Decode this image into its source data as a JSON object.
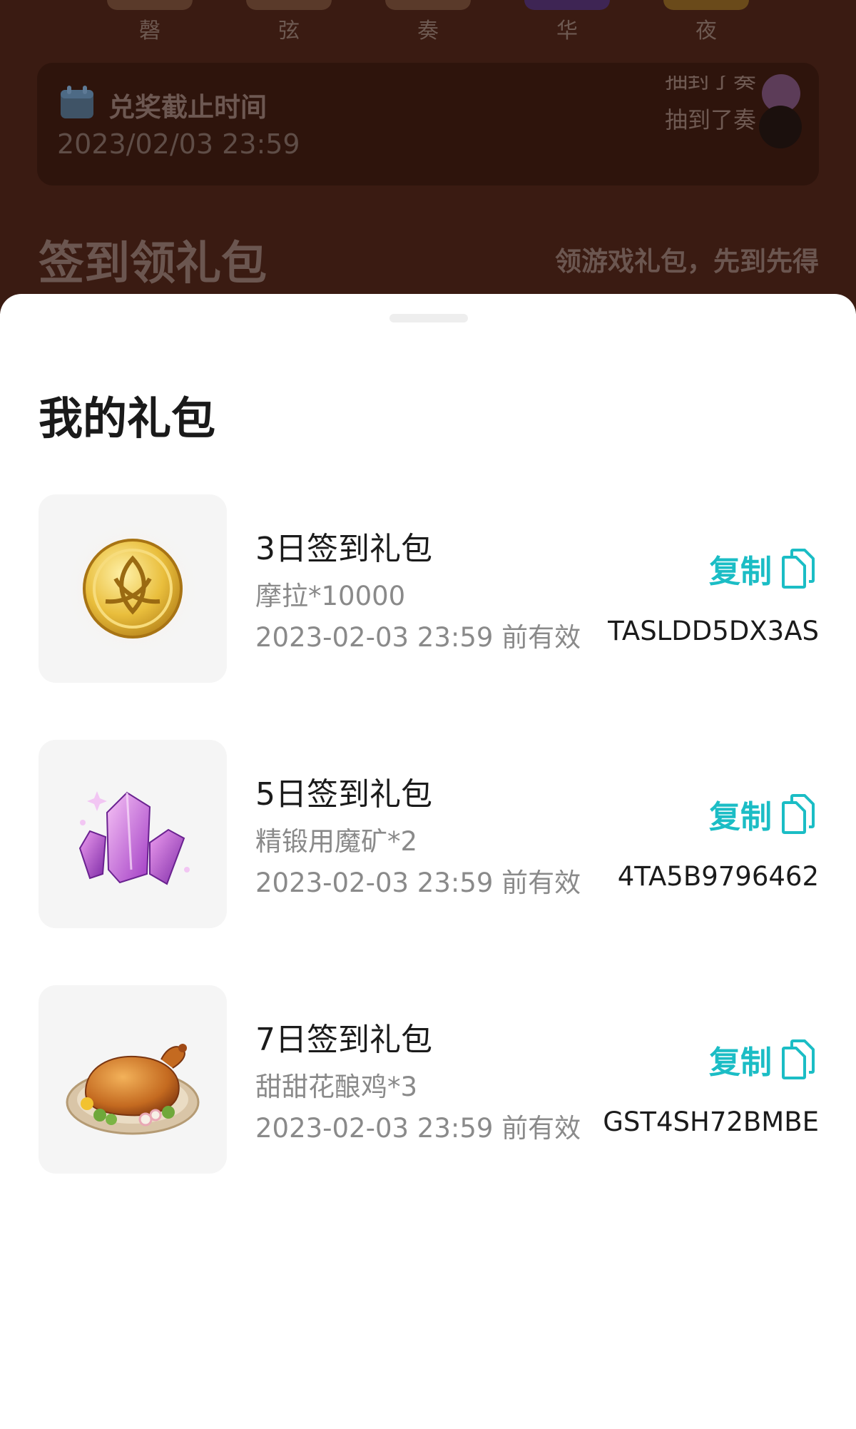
{
  "background": {
    "tabs": [
      {
        "label": "磬"
      },
      {
        "label": "弦"
      },
      {
        "label": "奏"
      },
      {
        "label": "华"
      },
      {
        "label": "夜"
      }
    ],
    "deadline": {
      "label": "兑奖截止时间",
      "value": "2023/02/03 23:59"
    },
    "ticker": {
      "line1": "抽封了奏",
      "line2": "抽到了奏"
    },
    "signin": {
      "title": "签到领礼包",
      "subtitle": "领游戏礼包，先到先得"
    }
  },
  "sheet": {
    "title": "我的礼包",
    "copy_label": "复制",
    "gifts": [
      {
        "name": "3日签到礼包",
        "content": "摩拉*10000",
        "expiry": "2023-02-03 23:59 前有效",
        "code": "TASLDD5DX3AS",
        "icon": "mora-coin-icon"
      },
      {
        "name": "5日签到礼包",
        "content": "精锻用魔矿*2",
        "expiry": "2023-02-03 23:59 前有效",
        "code": "4TA5B9796462",
        "icon": "mystic-ore-icon"
      },
      {
        "name": "7日签到礼包",
        "content": "甜甜花酿鸡*3",
        "expiry": "2023-02-03 23:59 前有效",
        "code": "GST4SH72BMBE",
        "icon": "roast-chicken-icon"
      }
    ]
  },
  "colors": {
    "accent": "#1bbdc5",
    "overlay_background": "#3a1b12",
    "secondary_text": "#8a8a8a"
  }
}
